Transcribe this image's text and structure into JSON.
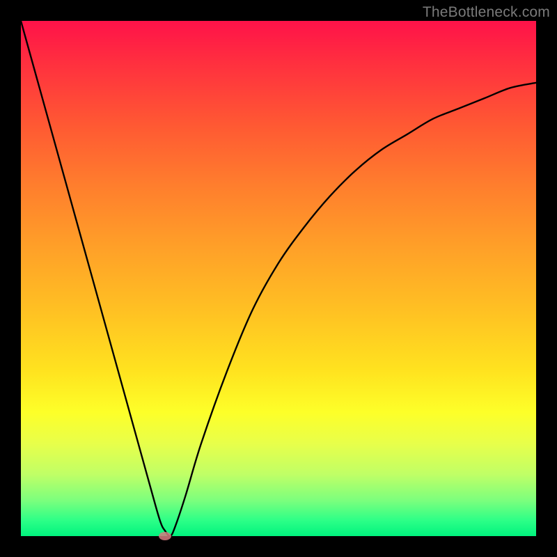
{
  "watermark": "TheBottleneck.com",
  "chart_data": {
    "type": "line",
    "title": "",
    "xlabel": "",
    "ylabel": "",
    "xlim": [
      0,
      100
    ],
    "ylim": [
      0,
      100
    ],
    "series": [
      {
        "name": "curve",
        "x": [
          0,
          5,
          10,
          15,
          20,
          25,
          27,
          28,
          29,
          30,
          32,
          35,
          40,
          45,
          50,
          55,
          60,
          65,
          70,
          75,
          80,
          85,
          90,
          95,
          100
        ],
        "y": [
          100,
          82,
          64,
          46,
          28,
          10,
          3,
          1,
          0,
          2,
          8,
          18,
          32,
          44,
          53,
          60,
          66,
          71,
          75,
          78,
          81,
          83,
          85,
          87,
          88
        ]
      }
    ],
    "marker": {
      "x": 28,
      "y": 0
    },
    "gradient_stops": [
      {
        "pos": 0.0,
        "color": "#ff1249"
      },
      {
        "pos": 0.2,
        "color": "#ff5833"
      },
      {
        "pos": 0.44,
        "color": "#ffa028"
      },
      {
        "pos": 0.68,
        "color": "#ffe31f"
      },
      {
        "pos": 0.88,
        "color": "#c0ff66"
      },
      {
        "pos": 1.0,
        "color": "#00f37e"
      }
    ]
  }
}
